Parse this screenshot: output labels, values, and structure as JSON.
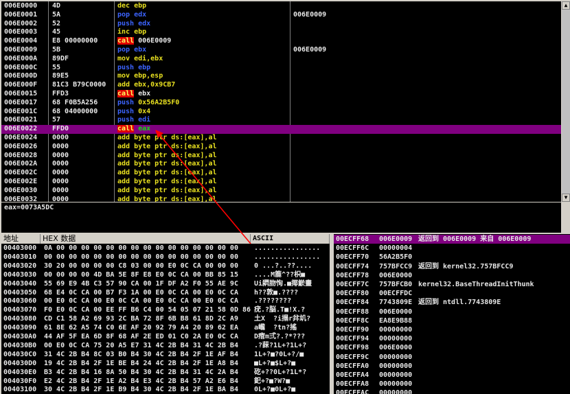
{
  "colors": {
    "keyword_red": "#ff2020",
    "green": "#10e010",
    "blue": "#3c64ff",
    "yellow": "#e8e020",
    "magenta": "#ff40ff",
    "selection": "#800080",
    "arrow": "#ff0000"
  },
  "disasm": [
    {
      "addr": "006E0000",
      "hex": "4D",
      "ins": [
        [
          "dec ",
          "y"
        ],
        [
          "ebp",
          "y"
        ]
      ],
      "cmt": ""
    },
    {
      "addr": "006E0001",
      "hex": "5A",
      "ins": [
        [
          "pop edx",
          "b"
        ]
      ],
      "cmt": "006E0009"
    },
    {
      "addr": "006E0002",
      "hex": "52",
      "ins": [
        [
          "push edx",
          "b"
        ]
      ],
      "cmt": ""
    },
    {
      "addr": "006E0003",
      "hex": "45",
      "ins": [
        [
          "inc ebp",
          "y"
        ]
      ],
      "cmt": ""
    },
    {
      "addr": "006E0004",
      "hex": "E8 00000000",
      "ins": [
        [
          "call",
          "r"
        ],
        [
          " 006E0009",
          "w"
        ]
      ],
      "cmt": ""
    },
    {
      "addr": "006E0009",
      "hex": "5B",
      "ins": [
        [
          "pop ebx",
          "b"
        ]
      ],
      "cmt": "006E0009"
    },
    {
      "addr": "006E000A",
      "hex": "89DF",
      "ins": [
        [
          "mov edi,ebx",
          "y"
        ]
      ],
      "cmt": ""
    },
    {
      "addr": "006E000C",
      "hex": "55",
      "ins": [
        [
          "push ebp",
          "b"
        ]
      ],
      "cmt": ""
    },
    {
      "addr": "006E000D",
      "hex": "89E5",
      "ins": [
        [
          "mov ebp,esp",
          "y"
        ]
      ],
      "cmt": ""
    },
    {
      "addr": "006E000F",
      "hex": "81C3 B79C0000",
      "ins": [
        [
          "add ebx,",
          "y"
        ],
        [
          "0x9CB7",
          "o"
        ]
      ],
      "cmt": ""
    },
    {
      "addr": "006E0015",
      "hex": "FFD3",
      "ins": [
        [
          "call",
          "r"
        ],
        [
          " ebx",
          "w"
        ]
      ],
      "cmt": ""
    },
    {
      "addr": "006E0017",
      "hex": "68 F0B5A256",
      "ins": [
        [
          "push ",
          "b"
        ],
        [
          "0x56A2B5F0",
          "o"
        ]
      ],
      "cmt": ""
    },
    {
      "addr": "006E001C",
      "hex": "68 04000000",
      "ins": [
        [
          "push ",
          "b"
        ],
        [
          "0x4",
          "o"
        ]
      ],
      "cmt": ""
    },
    {
      "addr": "006E0021",
      "hex": "57",
      "ins": [
        [
          "push edi",
          "b"
        ]
      ],
      "cmt": ""
    },
    {
      "addr": "006E0022",
      "hex": "FFD0",
      "ins": [
        [
          "call",
          "r"
        ],
        [
          " eax",
          "g"
        ]
      ],
      "cmt": "",
      "sel": true
    },
    {
      "addr": "006E0024",
      "hex": "0000",
      "ins": [
        [
          "add byte ptr ds:[eax],al",
          "y"
        ]
      ],
      "cmt": ""
    },
    {
      "addr": "006E0026",
      "hex": "0000",
      "ins": [
        [
          "add byte ptr ds:[eax],al",
          "y"
        ]
      ],
      "cmt": ""
    },
    {
      "addr": "006E0028",
      "hex": "0000",
      "ins": [
        [
          "add byte ptr ds:[eax],al",
          "y"
        ]
      ],
      "cmt": ""
    },
    {
      "addr": "006E002A",
      "hex": "0000",
      "ins": [
        [
          "add byte ptr ds:[eax],al",
          "y"
        ]
      ],
      "cmt": ""
    },
    {
      "addr": "006E002C",
      "hex": "0000",
      "ins": [
        [
          "add byte ptr ds:[eax],al",
          "y"
        ]
      ],
      "cmt": ""
    },
    {
      "addr": "006E002E",
      "hex": "0000",
      "ins": [
        [
          "add byte ptr ds:[eax],al",
          "y"
        ]
      ],
      "cmt": ""
    },
    {
      "addr": "006E0030",
      "hex": "0000",
      "ins": [
        [
          "add byte ptr ds:[eax],al",
          "y"
        ]
      ],
      "cmt": ""
    },
    {
      "addr": "006E0032",
      "hex": "0000",
      "ins": [
        [
          "add byte ptr ds:[eax],al",
          "y"
        ]
      ],
      "cmt": ""
    }
  ],
  "info_line": "eax=0073A5DC",
  "dump": {
    "headers": {
      "addr": "地址",
      "hex": "HEX 数据",
      "ascii": "ASCII"
    },
    "rows": [
      {
        "addr": "00403000",
        "hex": "0A 00 00 00 00 00 00 00 00 00 00 00 00 00 00 00",
        "ascii": "................"
      },
      {
        "addr": "00403010",
        "hex": "00 00 00 00 00 00 00 00 00 00 00 00 00 00 00 00",
        "ascii": "................"
      },
      {
        "addr": "00403020",
        "hex": "30 20 00 00 00 00 C8 03 00 00 E0 0C CA 00 00 00",
        "ascii": "0 ...?..??...."
      },
      {
        "addr": "00403030",
        "hex": "00 00 00 00 4D BA 5E 8F E8 E0 0C CA 00 BB 85 15",
        "ascii": "....M簏^??枳■"
      },
      {
        "addr": "00403040",
        "hex": "55 69 E9 4B C3 57 90 CA 00 1F DF A2 F0 55 AE 9C",
        "ascii": "Ui閷肳恂.■揶鯲畫"
      },
      {
        "addr": "00403050",
        "hex": "68 E4 0C CA 00 B7 F3 1A 00 E0 0C CA 00 E0 0C CA",
        "ascii": "h??敦■.????"
      },
      {
        "addr": "00403060",
        "hex": "00 E0 0C CA 00 E0 0C CA 00 E0 0C CA 00 E0 0C CA",
        "ascii": ".????????"
      },
      {
        "addr": "00403070",
        "hex": "F0 E0 0C CA 00 EE FF B6 C4 00 54 05 07 21 58 0D 86",
        "ascii": "疣.?脳.T■!X.?"
      },
      {
        "addr": "00403080",
        "hex": "CD C1 58 A2 69 93 2C BA 72 8F 6B B8 61 8D 2C A9",
        "ascii": "土X  ?i搨r弅竌?"
      },
      {
        "addr": "00403090",
        "hex": "61 8E 62 A5 74 C0 6E AF 20 92 79 A4 20 89 62 EA",
        "ascii": "a巄  ?tn?搖"
      },
      {
        "addr": "004030A0",
        "hex": "44 AF 5F EA 6D 8F 68 AF 2E ED 01 C0 2A E0 0C CA",
        "ascii": "D痯m弍?.?*???"
      },
      {
        "addr": "004030B0",
        "hex": "00 E0 0C CA 75 20 A5 E7 31 4C 2B B4 31 4C 2B B4",
        "ascii": ".?蔝?1L+?1L+?"
      },
      {
        "addr": "004030C0",
        "hex": "31 4C 2B B4 8C 03 B0 B4 30 4C 2B B4 2F 1E AF B4",
        "ascii": "1L+?■?0L+?/■"
      },
      {
        "addr": "004030D0",
        "hex": "19 4C 2B B4 2F 1E BE B4 24 4C 2B B4 2F 1E A8 B4",
        "ascii": "■L+?■$L+?■"
      },
      {
        "addr": "004030E0",
        "hex": "B3 4C 2B B4 16 8A 50 B4 30 4C 2B B4 31 4C 2A B4",
        "ascii": "矻+??0L+?1L*?"
      },
      {
        "addr": "004030F0",
        "hex": "E2 4C 2B B4 2F 1E A2 B4 E3 4C 2B B4 57 A2 E6 B4",
        "ascii": "釲+?■?W?■"
      },
      {
        "addr": "00403100",
        "hex": "30 4C 2B B4 2F 1E B9 B4 30 4C 2B B4 2F 1E BA B4",
        "ascii": "0L+?■0L+?■"
      }
    ]
  },
  "stack": [
    {
      "addr": "00ECFF68",
      "val": "006E0009",
      "cmt": "返回到 006E0009 来自 006E0009",
      "sel": true
    },
    {
      "addr": "00ECFF6C",
      "val": "00000004",
      "cmt": ""
    },
    {
      "addr": "00ECFF70",
      "val": "56A2B5F0",
      "cmt": ""
    },
    {
      "addr": "00ECFF74",
      "val": "757BFCC9",
      "cmt": "返回到 kernel32.757BFCC9"
    },
    {
      "addr": "00ECFF78",
      "val": "006E0000",
      "cmt": ""
    },
    {
      "addr": "00ECFF7C",
      "val": "757BFCB0",
      "cmt": "kernel32.BaseThreadInitThunk"
    },
    {
      "addr": "00ECFF80",
      "val": "00ECFFDC",
      "cmt": ""
    },
    {
      "addr": "00ECFF84",
      "val": "7743809E",
      "cmt": "返回到 ntdll.7743809E"
    },
    {
      "addr": "00ECFF88",
      "val": "006E0000",
      "cmt": ""
    },
    {
      "addr": "00ECFF8C",
      "val": "EA8E9B88",
      "cmt": ""
    },
    {
      "addr": "00ECFF90",
      "val": "00000000",
      "cmt": ""
    },
    {
      "addr": "00ECFF94",
      "val": "00000000",
      "cmt": ""
    },
    {
      "addr": "00ECFF98",
      "val": "006E0000",
      "cmt": ""
    },
    {
      "addr": "00ECFF9C",
      "val": "00000000",
      "cmt": ""
    },
    {
      "addr": "00ECFFA0",
      "val": "00000000",
      "cmt": ""
    },
    {
      "addr": "00ECFFA4",
      "val": "00000000",
      "cmt": ""
    },
    {
      "addr": "00ECFFA8",
      "val": "00000000",
      "cmt": ""
    },
    {
      "addr": "00ECFFAC",
      "val": "00000000",
      "cmt": ""
    }
  ]
}
